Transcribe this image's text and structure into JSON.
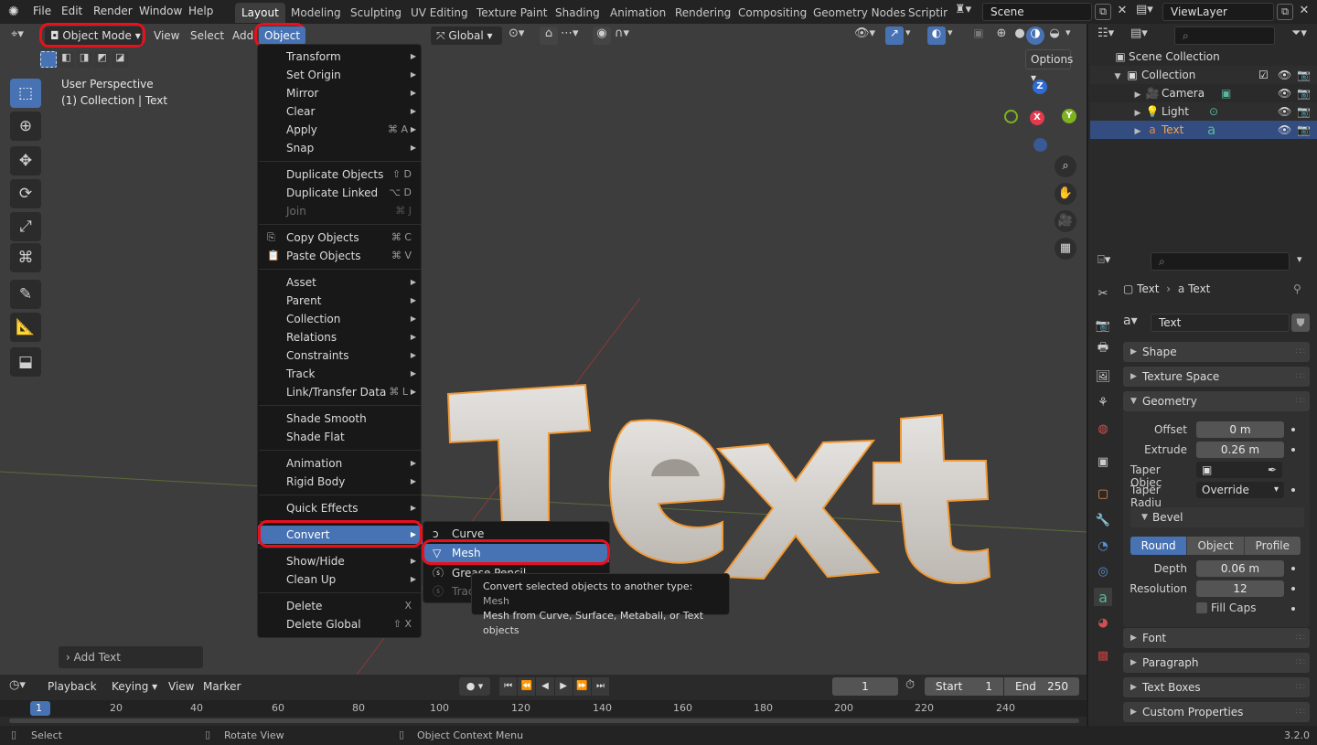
{
  "app": {
    "menus": [
      "File",
      "Edit",
      "Render",
      "Window",
      "Help"
    ],
    "workspaces": [
      "Layout",
      "Modeling",
      "Sculpting",
      "UV Editing",
      "Texture Paint",
      "Shading",
      "Animation",
      "Rendering",
      "Compositing",
      "Geometry Nodes",
      "Scripting"
    ],
    "active_workspace": "Layout",
    "scene": "Scene",
    "view_layer": "ViewLayer",
    "version": "3.2.0"
  },
  "viewport_header": {
    "mode": "Object Mode",
    "view": "View",
    "select": "Select",
    "add": "Add",
    "object": "Object",
    "orientation": "Global",
    "options": "Options"
  },
  "overlay": {
    "perspective": "User Perspective",
    "collection": "(1) Collection | Text",
    "last_op": "Add Text",
    "scene_text": "Text"
  },
  "gizmo": {
    "z": "Z",
    "x": "X",
    "y": "Y"
  },
  "object_menu": {
    "transform": "Transform",
    "set_origin": "Set Origin",
    "mirror": "Mirror",
    "clear": "Clear",
    "apply": "Apply",
    "apply_sc": "⌘ A",
    "snap": "Snap",
    "duplicate_objects": "Duplicate Objects",
    "duplicate_objects_sc": "⇧ D",
    "duplicate_linked": "Duplicate Linked",
    "duplicate_linked_sc": "⌥ D",
    "join": "Join",
    "join_sc": "⌘ J",
    "copy_objects": "Copy Objects",
    "copy_objects_sc": "⌘ C",
    "paste_objects": "Paste Objects",
    "paste_objects_sc": "⌘ V",
    "asset": "Asset",
    "parent": "Parent",
    "collection": "Collection",
    "relations": "Relations",
    "constraints": "Constraints",
    "track": "Track",
    "link_transfer": "Link/Transfer Data",
    "link_transfer_sc": "⌘ L",
    "shade_smooth": "Shade Smooth",
    "shade_flat": "Shade Flat",
    "animation": "Animation",
    "rigid_body": "Rigid Body",
    "quick_effects": "Quick Effects",
    "convert": "Convert",
    "show_hide": "Show/Hide",
    "clean_up": "Clean Up",
    "delete": "Delete",
    "delete_sc": "X",
    "delete_global": "Delete Global",
    "delete_global_sc": "⇧ X"
  },
  "convert_menu": {
    "curve": "Curve",
    "mesh": "Mesh",
    "grease_pencil": "Grease Pencil",
    "trace": "Trace"
  },
  "tooltip": {
    "line1": "Convert selected objects to another type:",
    "line1_value": "Mesh",
    "line2": "Mesh from Curve, Surface, Metaball, or Text objects"
  },
  "outliner": {
    "scene_collection": "Scene Collection",
    "collection": "Collection",
    "items": [
      "Camera",
      "Light",
      "Text"
    ]
  },
  "properties": {
    "breadcrumb_a": "Text",
    "breadcrumb_b": "Text",
    "datablock": "Text",
    "panels": {
      "shape": "Shape",
      "texture_space": "Texture Space",
      "geometry": "Geometry",
      "bevel": "Bevel",
      "font": "Font",
      "paragraph": "Paragraph",
      "text_boxes": "Text Boxes",
      "custom_properties": "Custom Properties"
    },
    "offset_label": "Offset",
    "offset": "0 m",
    "extrude_label": "Extrude",
    "extrude": "0.26 m",
    "taper_object_label": "Taper Objec",
    "taper_radius_label": "Taper Radiu",
    "taper_radius": "Override",
    "bevel_modes": [
      "Round",
      "Object",
      "Profile"
    ],
    "depth_label": "Depth",
    "depth": "0.06 m",
    "resolution_label": "Resolution",
    "resolution": "12",
    "fill_caps": "Fill Caps"
  },
  "timeline": {
    "playback": "Playback",
    "keying": "Keying",
    "view": "View",
    "marker": "Marker",
    "current_frame": "1",
    "start_label": "Start",
    "start": "1",
    "end_label": "End",
    "end": "250",
    "ruler": [
      "1",
      "20",
      "40",
      "60",
      "80",
      "100",
      "120",
      "140",
      "160",
      "180",
      "200",
      "220",
      "240"
    ]
  },
  "statusbar": {
    "select": "Select",
    "rotate": "Rotate View",
    "context": "Object Context Menu"
  },
  "colors": {
    "accent": "#4772b3",
    "highlight_ring": "#e8101c",
    "selection_outline": "#f09a38"
  }
}
